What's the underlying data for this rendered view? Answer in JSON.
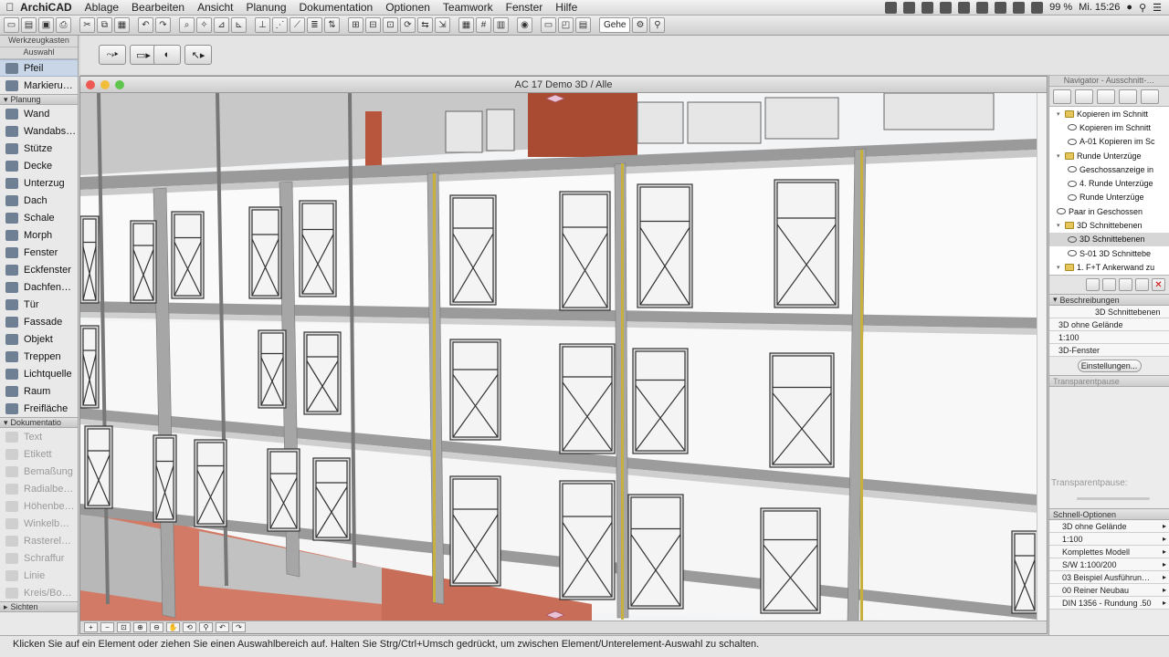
{
  "menubar": {
    "app": "ArchiCAD",
    "menus": [
      "Ablage",
      "Bearbeiten",
      "Ansicht",
      "Planung",
      "Dokumentation",
      "Optionen",
      "Teamwork",
      "Fenster",
      "Hilfe"
    ],
    "battery": "99 %",
    "clock": "Mi. 15:26"
  },
  "toolbar": {
    "goto": "Gehe"
  },
  "toolbox": {
    "title": "Werkzeugkasten",
    "select_section": "Auswahl",
    "planung_section": "Planung",
    "doku_section": "Dokumentatio",
    "sichten_section": "Sichten",
    "auswahl_tools": [
      {
        "label": "Pfeil",
        "icon": "arrow-pointer-icon"
      },
      {
        "label": "Markieru…",
        "icon": "marquee-icon"
      }
    ],
    "planung_tools": [
      {
        "label": "Wand",
        "icon": "wall-icon"
      },
      {
        "label": "Wandabs…",
        "icon": "curtain-wall-icon"
      },
      {
        "label": "Stütze",
        "icon": "column-icon"
      },
      {
        "label": "Decke",
        "icon": "slab-icon"
      },
      {
        "label": "Unterzug",
        "icon": "beam-icon"
      },
      {
        "label": "Dach",
        "icon": "roof-icon"
      },
      {
        "label": "Schale",
        "icon": "shell-icon"
      },
      {
        "label": "Morph",
        "icon": "morph-icon"
      },
      {
        "label": "Fenster",
        "icon": "window-icon"
      },
      {
        "label": "Eckfenster",
        "icon": "corner-window-icon"
      },
      {
        "label": "Dachfen…",
        "icon": "skylight-icon"
      },
      {
        "label": "Tür",
        "icon": "door-icon"
      },
      {
        "label": "Fassade",
        "icon": "facade-icon"
      },
      {
        "label": "Objekt",
        "icon": "object-icon"
      },
      {
        "label": "Treppen",
        "icon": "stair-icon"
      },
      {
        "label": "Lichtquelle",
        "icon": "lamp-icon"
      },
      {
        "label": "Raum",
        "icon": "zone-icon"
      },
      {
        "label": "Freifläche",
        "icon": "mesh-icon"
      }
    ],
    "doku_tools": [
      {
        "label": "Text",
        "icon": "text-icon"
      },
      {
        "label": "Etikett",
        "icon": "label-icon"
      },
      {
        "label": "Bemaßung",
        "icon": "dimension-icon"
      },
      {
        "label": "Radialbe…",
        "icon": "radial-dimension-icon"
      },
      {
        "label": "Höhenbe…",
        "icon": "level-dimension-icon"
      },
      {
        "label": "Winkelb…",
        "icon": "angle-dimension-icon"
      },
      {
        "label": "Rasterel…",
        "icon": "grid-element-icon"
      },
      {
        "label": "Schraffur",
        "icon": "fill-icon"
      },
      {
        "label": "Linie",
        "icon": "line-icon"
      },
      {
        "label": "Kreis/Bo…",
        "icon": "arc-icon"
      }
    ]
  },
  "window": {
    "title": "AC 17 Demo 3D / Alle"
  },
  "navigator": {
    "title": "Navigator - Ausschnitt-…",
    "tree": [
      {
        "label": "Kopieren im Schnitt",
        "type": "folder",
        "indent": 1
      },
      {
        "label": "Kopieren im Schnitt",
        "type": "view",
        "indent": 2
      },
      {
        "label": "A-01 Kopieren im Sc",
        "type": "view",
        "indent": 2
      },
      {
        "label": "Runde Unterzüge",
        "type": "folder",
        "indent": 1
      },
      {
        "label": "Geschossanzeige in",
        "type": "view",
        "indent": 2
      },
      {
        "label": "4. Runde Unterzüge",
        "type": "view",
        "indent": 2
      },
      {
        "label": "Runde Unterzüge",
        "type": "view",
        "indent": 2
      },
      {
        "label": "Paar in Geschossen",
        "type": "view",
        "indent": 1
      },
      {
        "label": "3D Schnittebenen",
        "type": "folder",
        "indent": 1
      },
      {
        "label": "3D Schnittebenen",
        "type": "view",
        "indent": 2,
        "selected": true
      },
      {
        "label": "S-01 3D Schnittebe",
        "type": "view",
        "indent": 2
      },
      {
        "label": "1. F+T Ankerwand zu",
        "type": "folder",
        "indent": 1
      }
    ],
    "beschreibungen": "Beschreibungen",
    "props": [
      "3D Schnittebenen",
      "3D ohne Gelände",
      "1:100",
      "3D-Fenster"
    ],
    "settings_btn": "Einstellungen...",
    "transparent_head": "Transparentpause",
    "transparent_label": "Transparentpause:",
    "schnell_head": "Schnell-Optionen",
    "schnell": [
      "3D ohne Gelände",
      "1:100",
      "Komplettes Modell",
      "S/W 1:100/200",
      "03 Beispiel Ausführun…",
      "00 Reiner Neubau",
      "DIN 1356 - Rundung .50"
    ]
  },
  "status": "Klicken Sie auf ein Element oder ziehen Sie einen Auswahlbereich auf. Halten Sie Strg/Ctrl+Umsch gedrückt, um zwischen Element/Unterelement-Auswahl zu schalten."
}
